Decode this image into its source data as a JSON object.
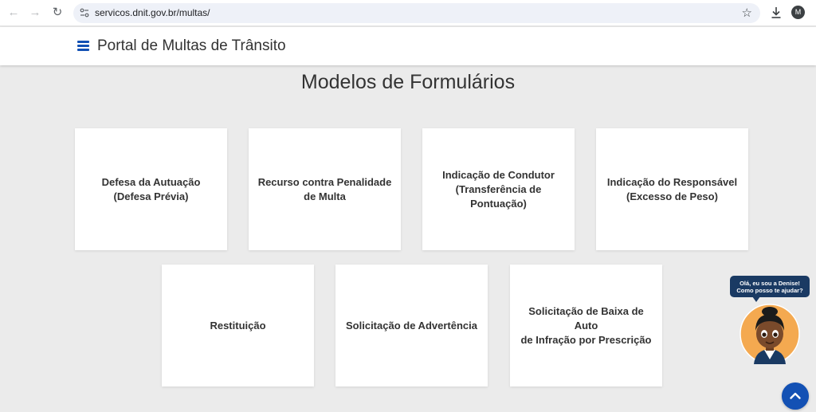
{
  "browser": {
    "url": "servicos.dnit.gov.br/multas/",
    "avatar_letter": "M"
  },
  "header": {
    "title": "Portal de Multas de Trânsito",
    "accent_color": "#1351b4"
  },
  "main": {
    "title": "Modelos de Formulários",
    "cards": [
      {
        "line1": "Defesa da Autuação",
        "line2": "(Defesa Prévia)"
      },
      {
        "line1": "Recurso contra Penalidade",
        "line2": "de Multa"
      },
      {
        "line1": "Indicação de Condutor",
        "line2": "(Transferência de Pontuação)"
      },
      {
        "line1": "Indicação do Responsável",
        "line2": "(Excesso de Peso)"
      },
      {
        "line1": "Restituição",
        "line2": ""
      },
      {
        "line1": "Solicitação de Advertência",
        "line2": ""
      },
      {
        "line1": "Solicitação de Baixa de Auto",
        "line2": "de Infração por Prescrição"
      }
    ]
  },
  "assistant": {
    "line1": "Olá, eu sou a Denise!",
    "line2": "Como posso te ajudar?",
    "bubble_color": "#1a3a63"
  }
}
